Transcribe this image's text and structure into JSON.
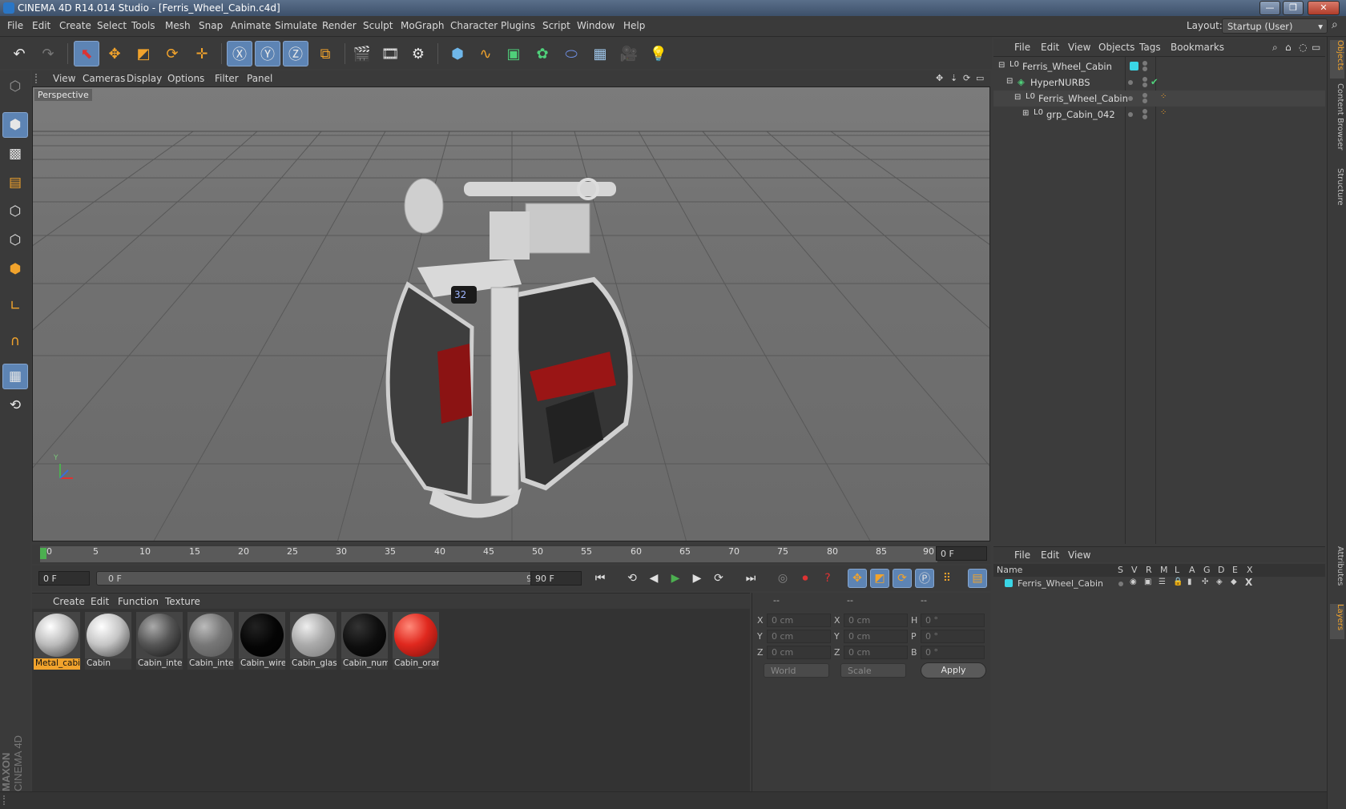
{
  "window": {
    "title": "CINEMA 4D R14.014 Studio - [Ferris_Wheel_Cabin.c4d]"
  },
  "menubar": {
    "items": [
      "File",
      "Edit",
      "Create",
      "Select",
      "Tools",
      "Mesh",
      "Snap",
      "Animate",
      "Simulate",
      "Render",
      "Sculpt",
      "MoGraph",
      "Character",
      "Plugins",
      "Script",
      "Window",
      "Help"
    ],
    "layout_label": "Layout:",
    "layout_value": "Startup (User)"
  },
  "viewport": {
    "menu": [
      "View",
      "Cameras",
      "Display",
      "Options",
      "Filter",
      "Panel"
    ],
    "label": "Perspective",
    "badge_number": "32"
  },
  "timeline": {
    "ticks": [
      "0",
      "5",
      "10",
      "15",
      "20",
      "25",
      "30",
      "35",
      "40",
      "45",
      "50",
      "55",
      "60",
      "65",
      "70",
      "75",
      "80",
      "85",
      "90"
    ],
    "current_frame": "0 F",
    "start_frame": "0 F",
    "range_start": "0 F",
    "range_end": "90 F",
    "end_frame": "90 F"
  },
  "materials": {
    "menu": [
      "Create",
      "Edit",
      "Function",
      "Texture"
    ],
    "items": [
      {
        "label": "Metal_cabi",
        "color": "#d8d8d8",
        "selected": true
      },
      {
        "label": "Cabin",
        "color": "#dcdcdc",
        "selected": false
      },
      {
        "label": "Cabin_inte",
        "color": "#6b6b6b",
        "selected": false
      },
      {
        "label": "Cabin_inte",
        "color": "#7a7a7a",
        "selected": false
      },
      {
        "label": "Cabin_wire",
        "color": "#050505",
        "selected": false
      },
      {
        "label": "Cabin_glas",
        "color": "#bdbdbd",
        "selected": false
      },
      {
        "label": "Cabin_num",
        "color": "#0e0e0e",
        "selected": false
      },
      {
        "label": "Cabin_orar",
        "color": "#e0281e",
        "selected": false
      }
    ]
  },
  "coordinates": {
    "header": [
      "--",
      "--",
      "--"
    ],
    "rows": [
      {
        "a": "X",
        "av": "0 cm",
        "b": "X",
        "bv": "0 cm",
        "c": "H",
        "cv": "0 °"
      },
      {
        "a": "Y",
        "av": "0 cm",
        "b": "Y",
        "bv": "0 cm",
        "c": "P",
        "cv": "0 °"
      },
      {
        "a": "Z",
        "av": "0 cm",
        "b": "Z",
        "bv": "0 cm",
        "c": "B",
        "cv": "0 °"
      }
    ],
    "mode1": "World",
    "mode2": "Scale",
    "apply": "Apply"
  },
  "objects": {
    "menu": [
      "File",
      "Edit",
      "View",
      "Objects",
      "Tags",
      "Bookmarks"
    ],
    "tree": [
      {
        "label": "Ferris_Wheel_Cabin"
      },
      {
        "label": "HyperNURBS"
      },
      {
        "label": "Ferris_Wheel_Cabin"
      },
      {
        "label": "grp_Cabin_042"
      }
    ]
  },
  "layers": {
    "menu": [
      "File",
      "Edit",
      "View"
    ],
    "columns": [
      "Name",
      "S",
      "V",
      "R",
      "M",
      "L",
      "A",
      "G",
      "D",
      "E",
      "X"
    ],
    "rows": [
      {
        "name": "Ferris_Wheel_Cabin"
      }
    ]
  },
  "side_tabs": [
    "Objects",
    "Content Browser",
    "Structure",
    "Attributes",
    "Layers"
  ],
  "branding": {
    "line1": "MAXON",
    "line2": "CINEMA 4D"
  },
  "colors": {
    "accent": "#f1a32c",
    "selection": "#5d84b4",
    "layer_color": "#3ad6e6"
  }
}
